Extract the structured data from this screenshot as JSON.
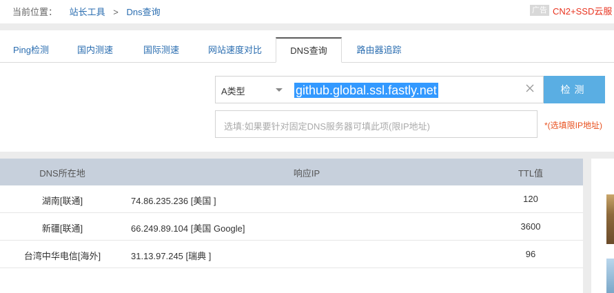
{
  "breadcrumb": {
    "prefix": "当前位置：",
    "crumbs": [
      "站长工具",
      "Dns查询"
    ],
    "separator": ">"
  },
  "ad": {
    "badge": "广告",
    "text": "CN2+SSD云服"
  },
  "tabs": [
    {
      "label": "Ping检测",
      "active": false
    },
    {
      "label": "国内测速",
      "active": false
    },
    {
      "label": "国际测速",
      "active": false
    },
    {
      "label": "网站速度对比",
      "active": false
    },
    {
      "label": "DNS查询",
      "active": true
    },
    {
      "label": "路由器追踪",
      "active": false
    }
  ],
  "query": {
    "record_type": "A类型",
    "domain_value": "github.global.ssl.fastly.net",
    "detect_button": "检测",
    "dns_placeholder": "选填:如果要针对固定DNS服务器可填此项(限IP地址)",
    "dns_hint": "*(选填限IP地址)"
  },
  "results": {
    "headers": [
      "DNS所在地",
      "响应IP",
      "TTL值"
    ],
    "rows": [
      {
        "location": "湖南[联通]",
        "ip": "74.86.235.236 [美国 ]",
        "ttl": "120"
      },
      {
        "location": "新疆[联通]",
        "ip": "66.249.89.104 [美国 Google]",
        "ttl": "3600"
      },
      {
        "location": "台湾中华电信[海外]",
        "ip": "31.13.97.245 [瑞典 ]",
        "ttl": "96"
      }
    ]
  },
  "colors": {
    "link": "#2a6db0",
    "accent_button": "#5aaee3",
    "selection": "#3399ff",
    "table_header": "#c7d0dc",
    "hint": "#e8501e",
    "ad": "#e8321e"
  },
  "icons": {
    "clear": "close-icon",
    "select_caret": "caret-down-icon"
  }
}
